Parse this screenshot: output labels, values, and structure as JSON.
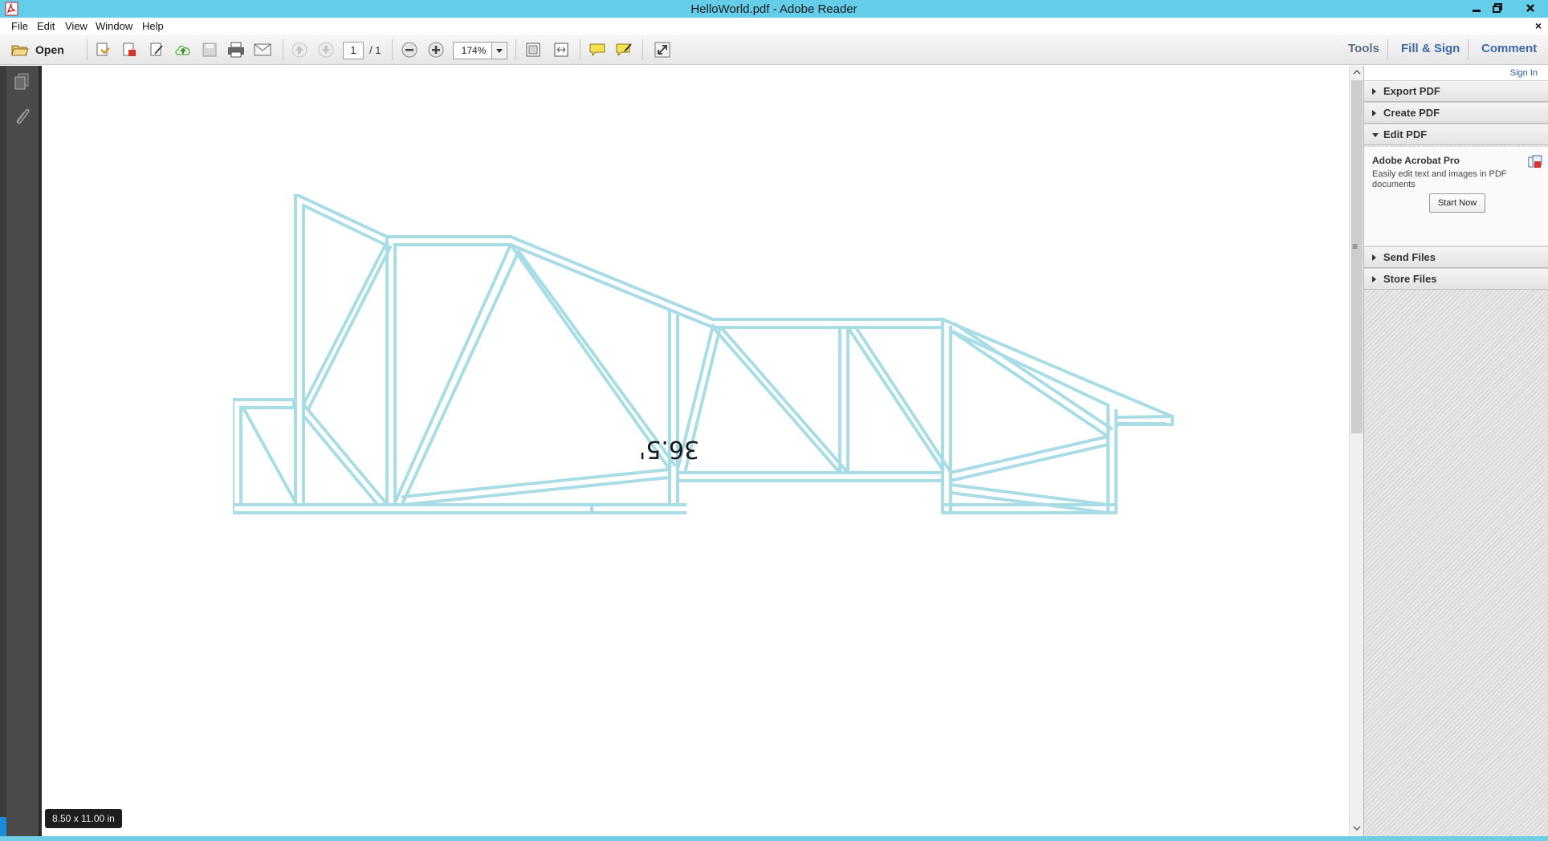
{
  "window": {
    "title": "HelloWorld.pdf - Adobe Reader"
  },
  "menu": {
    "items": [
      "File",
      "Edit",
      "View",
      "Window",
      "Help"
    ],
    "close_glyph": "×"
  },
  "toolbar": {
    "open_label": "Open",
    "page_current": "1",
    "page_total": "/ 1",
    "zoom": "174%",
    "tabs": {
      "tools": "Tools",
      "fill_sign": "Fill & Sign",
      "comment": "Comment"
    }
  },
  "document": {
    "dimension_label": "36.5'",
    "page_size": "8.50 x 11.00 in",
    "line_color": "#a9dde5"
  },
  "right_panel": {
    "sign_in": "Sign In",
    "sections": {
      "export_pdf": "Export PDF",
      "create_pdf": "Create PDF",
      "edit_pdf": "Edit PDF",
      "send_files": "Send Files",
      "store_files": "Store Files"
    },
    "promo": {
      "title": "Adobe Acrobat Pro",
      "description": "Easily edit text and images in PDF documents",
      "button": "Start Now"
    }
  },
  "colors": {
    "titlebar": "#63cdea",
    "accent_blue": "#3f6aa6"
  }
}
